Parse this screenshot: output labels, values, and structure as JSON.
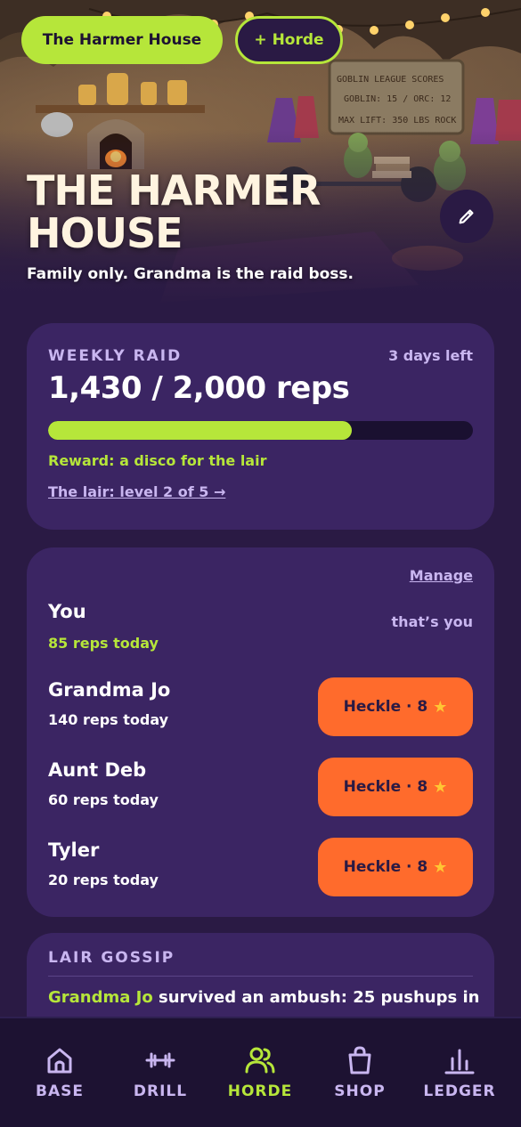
{
  "hero": {
    "house_pill": "The Harmer House",
    "horde_pill": "+ Horde",
    "title": "THE HARMER HOUSE",
    "subtitle": "Family only. Grandma is the raid boss.",
    "sign_line1": "GOBLIN LEAGUE SCORES",
    "sign_line2": "GOBLIN: 15 / ORC: 12",
    "sign_line3": "MAX LIFT: 350 LBS ROCK",
    "edit_icon": "pencil-icon"
  },
  "raid": {
    "label": "WEEKLY RAID",
    "time_left": "3 days left",
    "count": "1,430 / 2,000 reps",
    "progress": 0.715,
    "reward": "Reward: a disco for the lair",
    "lair_link": "The lair: level 2 of 5 →"
  },
  "horde": {
    "manage": "Manage",
    "me": {
      "name": "You",
      "reps": "85 reps today",
      "tag": "that’s you"
    },
    "members": [
      {
        "name": "Grandma Jo",
        "reps": "140 reps today",
        "button": "Heckle · 8"
      },
      {
        "name": "Aunt Deb",
        "reps": "60 reps today",
        "button": "Heckle · 8"
      },
      {
        "name": "Tyler",
        "reps": "20 reps today",
        "button": "Heckle · 8"
      }
    ]
  },
  "gossip": {
    "label": "LAIR GOSSIP",
    "name": "Grandma Jo",
    "text": " survived an ambush: 25 pushups in"
  },
  "nav": {
    "items": [
      {
        "label": "BASE",
        "icon": "home-icon"
      },
      {
        "label": "DRILL",
        "icon": "dumbbell-icon"
      },
      {
        "label": "HORDE",
        "icon": "group-icon"
      },
      {
        "label": "SHOP",
        "icon": "shopping-bag-icon"
      },
      {
        "label": "LEDGER",
        "icon": "bar-chart-icon"
      }
    ],
    "active": "HORDE"
  },
  "colors": {
    "background": "#2a1a44",
    "card": "#3b2563",
    "accent_green": "#b6e63a",
    "accent_orange": "#ff6b2c",
    "muted_lavender": "#c9b6f0",
    "star": "#ffc733"
  }
}
